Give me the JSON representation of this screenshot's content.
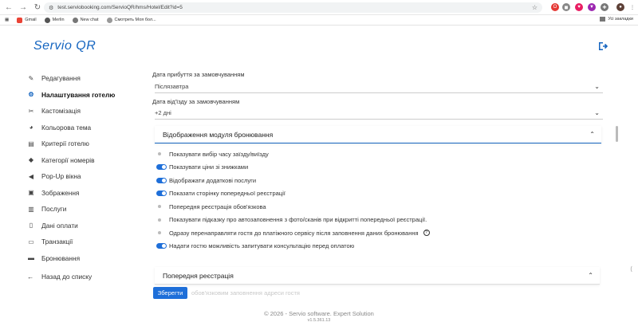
{
  "browser": {
    "url": "test.serviobooking.com/ServioQR/hms/Hotel/Edit?id=5",
    "bookmarks": [
      "Gmail",
      "Merlin",
      "New chat",
      "Смотреть Моя бол..."
    ],
    "bookmarks_right": "Усі закладки"
  },
  "header": {
    "logo_text": "Servio QR",
    "logout_icon": "logout-icon"
  },
  "sidebar": {
    "items": [
      {
        "label": "Редагування",
        "icon": "pencil-icon"
      },
      {
        "label": "Налаштування готелю",
        "icon": "gear-icon",
        "active": true
      },
      {
        "label": "Кастомізація",
        "icon": "tools-icon"
      },
      {
        "label": "Кольорова тема",
        "icon": "palette-icon"
      },
      {
        "label": "Критерії готелю",
        "icon": "filter-icon"
      },
      {
        "label": "Категорії номерів",
        "icon": "tag-icon"
      },
      {
        "label": "Pop-Up вікна",
        "icon": "megaphone-icon"
      },
      {
        "label": "Зображення",
        "icon": "image-icon"
      },
      {
        "label": "Послуги",
        "icon": "services-icon"
      },
      {
        "label": "Дані оплати",
        "icon": "document-icon"
      },
      {
        "label": "Транзакції",
        "icon": "transactions-icon"
      },
      {
        "label": "Бронювання",
        "icon": "bed-icon"
      }
    ],
    "back_label": "Назад до списку"
  },
  "form": {
    "arrival_label": "Дата прибуття за замовчуванням",
    "arrival_value": "Післязавтра",
    "departure_label": "Дата від'їзду за замовчуванням",
    "departure_value": "+2 дні"
  },
  "booking_module": {
    "title": "Відображення модуля бронювання",
    "toggles": [
      {
        "label": "Показувати вибір часу заїзду/виїзду",
        "on": false
      },
      {
        "label": "Показувати ціни зі знижками",
        "on": true
      },
      {
        "label": "Відображати додаткові послуги",
        "on": true
      },
      {
        "label": "Показати сторінку попередньої реєстрації",
        "on": true
      },
      {
        "label": "Попередня реєстрація обов'язкова",
        "on": false
      },
      {
        "label": "Показувати підказку про автозаповнення з фото/сканів при відкритті попередньої реєстрації.",
        "on": false
      },
      {
        "label": "Одразу перенаправляти гостя до платіжного сервісу після заповнення даних бронювання",
        "on": false,
        "help": "?"
      },
      {
        "label": "Надати гостю можливість запитувати консультацію перед оплатою",
        "on": true
      }
    ]
  },
  "pre_registration": {
    "title": "Попередня реєстрація",
    "faded_text": "обов'язковим заповнення адреси гостя"
  },
  "actions": {
    "save_label": "Зберегти"
  },
  "footer": {
    "copyright": "© 2026 - Servio software. Expert Solution",
    "version": "v1.5.361.13"
  },
  "colors": {
    "accent": "#1e6fd9",
    "brand": "#1565c0"
  }
}
